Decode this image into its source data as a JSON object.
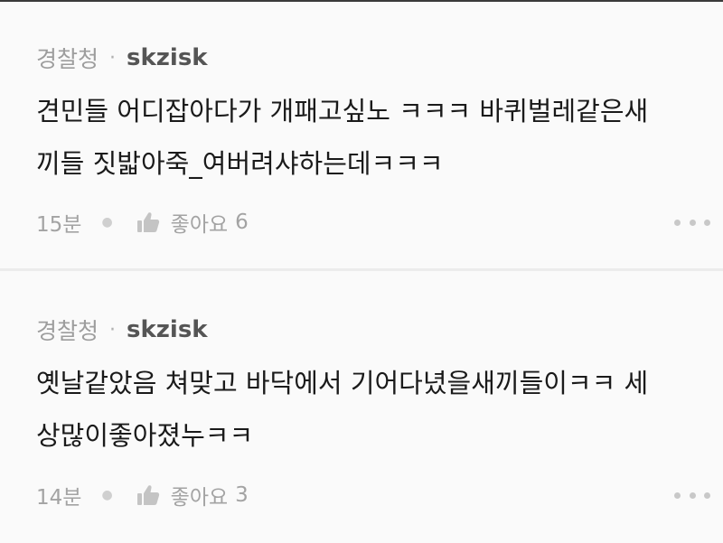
{
  "comments": [
    {
      "agency": "경찰청",
      "separator": "·",
      "username": "skzisk",
      "body_lines": [
        "견민들 어디잡아다가 개패고싶노 ㅋㅋㅋ 바퀴벌레같은새",
        "끼들 짓밟아죽_여버려샤하는데ㅋㅋㅋ"
      ],
      "time": "15분",
      "like_icon": "thumbs-up-icon",
      "like_label": "좋아요",
      "like_count": "6",
      "more_icon": "more-dots-icon"
    },
    {
      "agency": "경찰청",
      "separator": "·",
      "username": "skzisk",
      "body_lines": [
        "옛날같았음 쳐맞고 바닥에서 기어다녔을새끼들이ㅋㅋ 세",
        "상많이좋아졌누ㅋㅋ"
      ],
      "time": "14분",
      "like_icon": "thumbs-up-icon",
      "like_label": "좋아요",
      "like_count": "3",
      "more_icon": "more-dots-icon"
    }
  ]
}
